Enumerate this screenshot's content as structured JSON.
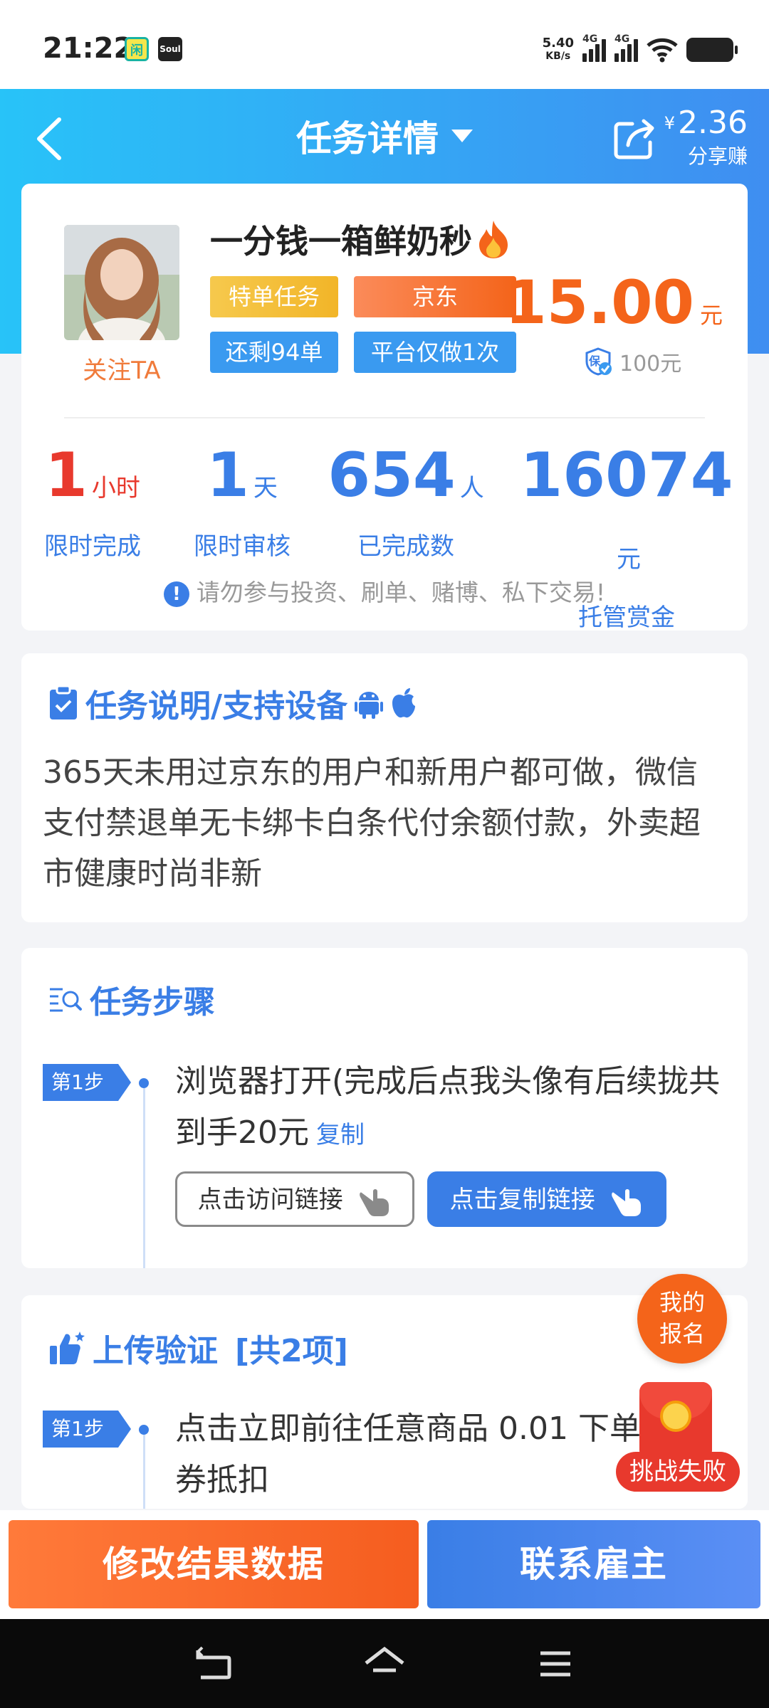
{
  "status_bar": {
    "time": "21:22",
    "app_icons": [
      "闲",
      "Soul"
    ],
    "net_speed_value": "5.40",
    "net_speed_unit": "KB/s",
    "signal_labels": [
      "4G",
      "4G"
    ]
  },
  "header": {
    "title": "任务详情",
    "share_currency": "¥",
    "share_amount": "2.36",
    "share_label": "分享赚"
  },
  "task": {
    "name": "一分钱一箱鲜奶秒",
    "follow_label": "关注TA",
    "tags": [
      "特单任务",
      "京东",
      "还剩94单",
      "平台仅做1次"
    ],
    "price": "15.00",
    "price_unit": "元",
    "deposit_badge": "保",
    "deposit": "100元",
    "stats": [
      {
        "value": "1",
        "unit": "小时",
        "label": "限时完成"
      },
      {
        "value": "1",
        "unit": "天",
        "label": "限时审核"
      },
      {
        "value": "654",
        "unit": "人",
        "label": "已完成数"
      },
      {
        "value": "16074",
        "unit": "元",
        "label": "托管赏金"
      }
    ],
    "notice_icon": "!",
    "notice": "请勿参与投资、刷单、赌博、私下交易!"
  },
  "description": {
    "title": "任务说明/支持设备",
    "text": "365天未用过京东的用户和新用户都可做，微信支付禁退单无卡绑卡白条代付余额付款，外卖超市健康时尚非新"
  },
  "steps": {
    "title": "任务步骤",
    "items": [
      {
        "badge": "第1步",
        "text": "浏览器打开(完成后点我头像有后续拢共到手20元",
        "copy_label": "复制",
        "visit_button": "点击访问链接",
        "copy_button": "点击复制链接"
      }
    ]
  },
  "upload": {
    "title": "上传验证",
    "count_label": "[共2项]",
    "items": [
      {
        "badge": "第1步",
        "text": "点击立即前往任意商品 0.01 下单优惠券抵扣"
      }
    ]
  },
  "floating": {
    "register_line1": "我的",
    "register_line2": "报名",
    "challenge_fail": "挑战失败"
  },
  "actions": {
    "modify_label": "修改结果数据",
    "contact_label": "联系雇主"
  },
  "colors": {
    "primary_blue": "#3a7ee6",
    "orange": "#f4641a",
    "header_gradient_start": "#28c3f8",
    "header_gradient_end": "#3f8ef1",
    "red": "#e8392d"
  },
  "icons": [
    "back-arrow-icon",
    "caret-down-icon",
    "share-icon",
    "fire-icon",
    "shield-check-icon",
    "info-icon",
    "clipboard-icon",
    "android-icon",
    "apple-icon",
    "search-list-icon",
    "pointing-hand-icon",
    "thumbs-up-icon"
  ]
}
